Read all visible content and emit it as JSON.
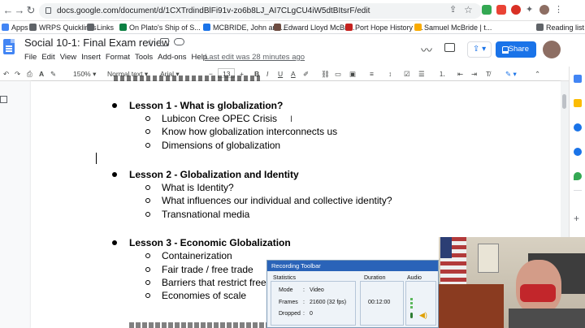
{
  "browser": {
    "url": "docs.google.com/document/d/1CXTrdindBlFi91v-zo6b8LJ_AI7CLgCU4iW5dtBItsrF/edit",
    "bookmarks": [
      "Apps",
      "WRPS Quicklinks",
      "Links",
      "On Plato's Ship of S...",
      "MCBRIDE, John and...",
      "Edward Lloyd McBri...",
      "Port Hope History -...",
      "Samuel McBride | t...",
      "Reading list"
    ]
  },
  "doc": {
    "title": "Social 10-1:  Final Exam review",
    "menus": [
      "File",
      "Edit",
      "View",
      "Insert",
      "Format",
      "Tools",
      "Add-ons",
      "Help"
    ],
    "last_edit": "Last edit was 28 minutes ago",
    "share_label": "Share"
  },
  "toolbar": {
    "zoom": "150%",
    "style": "Normal text",
    "font": "Arial",
    "size": "13"
  },
  "content": {
    "lessons": [
      {
        "title": "Lesson 1 - What is globalization?",
        "items": [
          "Lubicon Cree OPEC Crisis",
          "Know how globalization interconnects us",
          "Dimensions of globalization"
        ]
      },
      {
        "title": "Lesson 2 - Globalization and Identity",
        "items": [
          "What is Identity?",
          "What influences our individual and collective identity?",
          "Transnational media"
        ]
      },
      {
        "title": "Lesson 3 - Economic Globalization",
        "items": [
          "Containerization",
          "Fair trade  /   free trade",
          "Barriers that restrict free",
          "Economies of scale"
        ]
      }
    ]
  },
  "recording": {
    "title": "Recording Toolbar",
    "statistics_label": "Statistics",
    "duration_label": "Duration",
    "audio_label": "Audio",
    "mode_label": "Mode",
    "mode_value": "Video",
    "frames_label": "Frames",
    "frames_value": "21600 (32 fps)",
    "dropped_label": "Dropped",
    "dropped_value": "0",
    "duration_value": "00:12:00"
  },
  "colors": {
    "accent": "#1a73e8",
    "doc_blue": "#4285f4"
  }
}
